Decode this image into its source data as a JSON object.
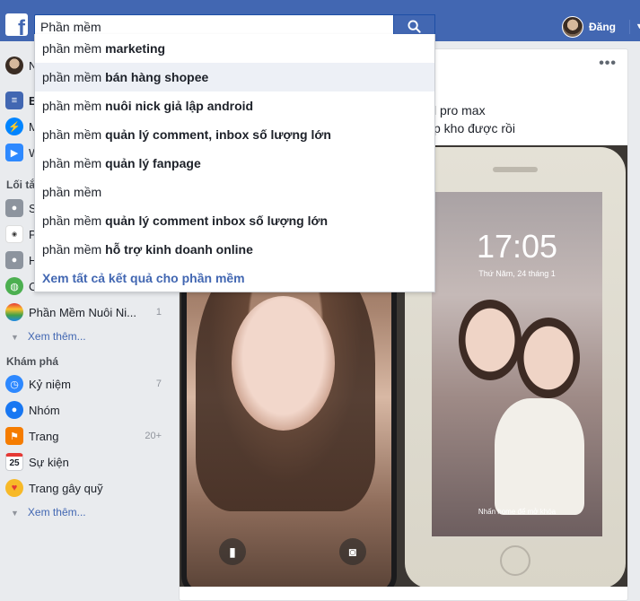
{
  "topbar": {
    "logo_letter": "f",
    "search_value": "Phần mềm",
    "user_name": "Đăng"
  },
  "suggestions": {
    "prefix": "phần mềm",
    "items": [
      {
        "bold": "marketing"
      },
      {
        "bold": "bán hàng shopee"
      },
      {
        "bold": "nuôi nick giả lập android"
      },
      {
        "bold": "quản lý comment, inbox số lượng lớn"
      },
      {
        "bold": "quản lý fanpage"
      },
      {
        "bold": ""
      },
      {
        "bold": "quản lý comment inbox số lượng lớn"
      },
      {
        "bold": "hỗ trợ kinh doanh online"
      }
    ],
    "see_all": "Xem tất cả kết quả cho phần mềm"
  },
  "sidebar": {
    "profile_initial": "N",
    "shortcut_partials": [
      "E",
      "M",
      "W"
    ],
    "shortcuts_heading_partial": "Lối tắ",
    "shortcut_items_partial": [
      "S",
      "P",
      "H",
      "C"
    ],
    "shortcut_last": {
      "label": "Phần Mềm Nuôi Ni...",
      "count": "1"
    },
    "see_more": "Xem thêm...",
    "explore_heading": "Khám phá",
    "explore": [
      {
        "label": "Kỷ niệm",
        "count": "7"
      },
      {
        "label": "Nhóm",
        "count": ""
      },
      {
        "label": "Trang",
        "count": "20+"
      },
      {
        "label": "Sự kiện",
        "count": ""
      },
      {
        "label": "Trang gây quỹ",
        "count": ""
      }
    ],
    "see_more_2": "Xem thêm...",
    "event_day": "25"
  },
  "post": {
    "more": "•••",
    "line1": "l pro max",
    "line2": "p kho được rồi",
    "phone_time": "17:05",
    "phone_date": "Thứ Năm, 24 tháng 1",
    "phone_hint": "Nhấn home để mở khóa"
  },
  "colors": {
    "brand": "#4267b2",
    "link": "#4267b2",
    "page_bg": "#e9ebee"
  }
}
